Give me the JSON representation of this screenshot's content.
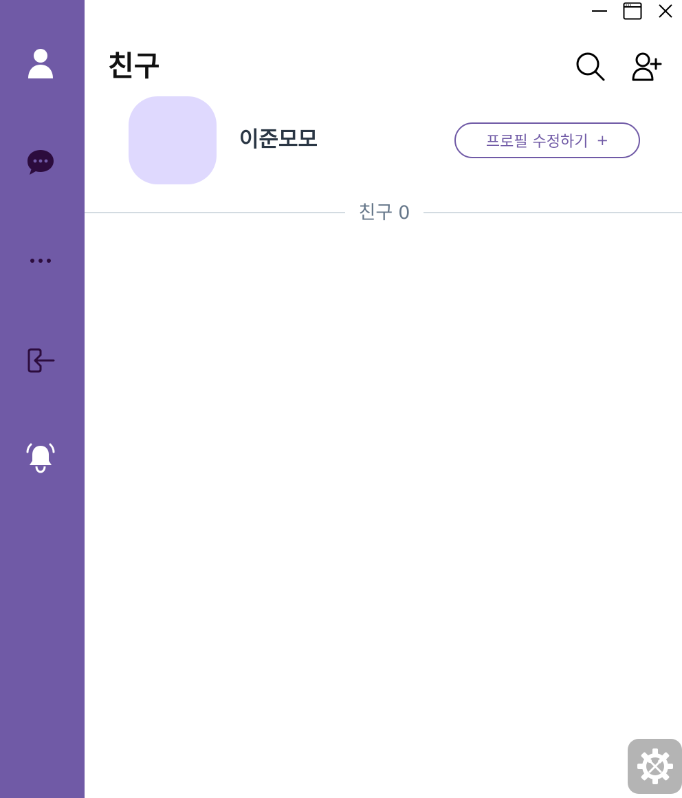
{
  "window_controls": {
    "minimize": "minimize-icon",
    "maximize": "maximize-icon",
    "close": "close-icon"
  },
  "sidebar": {
    "items": [
      {
        "name": "friends",
        "icon": "user-icon"
      },
      {
        "name": "chats",
        "icon": "chat-bubble-icon"
      },
      {
        "name": "more",
        "icon": "more-dots-icon"
      },
      {
        "name": "logout",
        "icon": "logout-icon"
      },
      {
        "name": "notifications",
        "icon": "bell-icon"
      }
    ]
  },
  "header": {
    "title": "친구",
    "search_icon": "search-icon",
    "add_friend_icon": "add-friend-icon"
  },
  "profile": {
    "name": "이준모모",
    "edit_button_label": "프로필 수정하기",
    "edit_button_plus": "+"
  },
  "friends_section": {
    "label": "친구",
    "count": "0"
  },
  "settings_fab": {
    "icon": "settings-tools-icon"
  },
  "colors": {
    "sidebar": "#705aa6",
    "avatar": "#dfd9fe",
    "accent": "#705aa6",
    "icon_dark": "#2c0c3d",
    "fab": "#b4b4b4"
  }
}
